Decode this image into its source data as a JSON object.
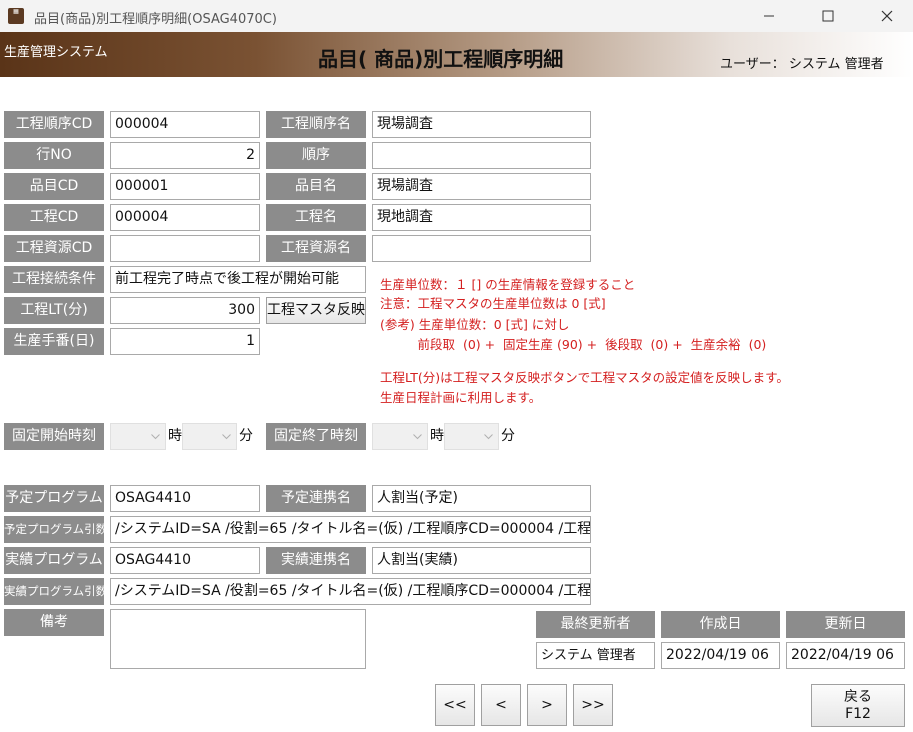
{
  "window": {
    "title": "品目(商品)別工程順序明細(OSAG4070C)",
    "icon_name": "app-window-icon"
  },
  "header": {
    "system_name": "生産管理システム",
    "page_title": "品目( 商品)別工程順序明細",
    "user_label": "ユーザー：",
    "user_name": "システム 管理者"
  },
  "form": {
    "process_order_cd": {
      "label": "工程順序CD",
      "value": "000004"
    },
    "process_order_name": {
      "label": "工程順序名",
      "value": "現場調査"
    },
    "row_no": {
      "label": "行NO",
      "value": "2"
    },
    "order": {
      "label": "順序",
      "value": ""
    },
    "item_cd": {
      "label": "品目CD",
      "value": "000001"
    },
    "item_name": {
      "label": "品目名",
      "value": "現場調査"
    },
    "process_cd": {
      "label": "工程CD",
      "value": "000004"
    },
    "process_name": {
      "label": "工程名",
      "value": "現地調査"
    },
    "resource_cd": {
      "label": "工程資源CD",
      "value": ""
    },
    "resource_name": {
      "label": "工程資源名",
      "value": ""
    },
    "connection_condition": {
      "label": "工程接続条件",
      "value": "前工程完了時点で後工程が開始可能"
    },
    "process_lt": {
      "label": "工程LT(分)",
      "value": "300"
    },
    "reflect_button": "工程マスタ反映",
    "production_days": {
      "label": "生産手番(日)",
      "value": "1"
    },
    "fixed_start": {
      "label": "固定開始時刻",
      "hour_unit": "時",
      "minute_unit": "分"
    },
    "fixed_end": {
      "label": "固定終了時刻",
      "hour_unit": "時",
      "minute_unit": "分"
    },
    "plan_program": {
      "label": "予定プログラム",
      "value": "OSAG4410"
    },
    "plan_link_name": {
      "label": "予定連携名",
      "value": "人割当(予定)"
    },
    "plan_program_args": {
      "label": "予定プログラム引数",
      "value": "/システムID=SA /役割=65 /タイトル名=(仮) /工程順序CD=000004 /工程"
    },
    "actual_program": {
      "label": "実績プログラム",
      "value": "OSAG4410"
    },
    "actual_link_name": {
      "label": "実績連携名",
      "value": "人割当(実績)"
    },
    "actual_program_args": {
      "label": "実績プログラム引数",
      "value": "/システムID=SA /役割=65 /タイトル名=(仮) /工程順序CD=000004 /工程"
    },
    "remarks": {
      "label": "備考",
      "value": ""
    }
  },
  "notes": [
    "生産単位数：１ [] の生産情報を登録すること",
    "注意：工程マスタの生産単位数は 0 [式]",
    "(参考) 生産単位数：0 [式] に対し",
    "　　　前段取  (0) +  固定生産 (90) +  後段取  (0) +  生産余裕  (0)",
    "工程LT(分)は工程マスタ反映ボタンで工程マスタの設定値を反映します。",
    "生産日程計画に利用します。"
  ],
  "audit": {
    "last_updater_label": "最終更新者",
    "created_label": "作成日",
    "updated_label": "更新日",
    "last_updater": "システム 管理者",
    "created": "2022/04/19 06",
    "updated": "2022/04/19 06"
  },
  "nav": {
    "first": "<<",
    "prev": "<",
    "next": ">",
    "last": ">>",
    "back_line1": "戻る",
    "back_line2": "F12"
  },
  "colors": {
    "header_dark": "#5a3418",
    "label_bg": "#8c8c8c",
    "note_red": "#d42020"
  }
}
